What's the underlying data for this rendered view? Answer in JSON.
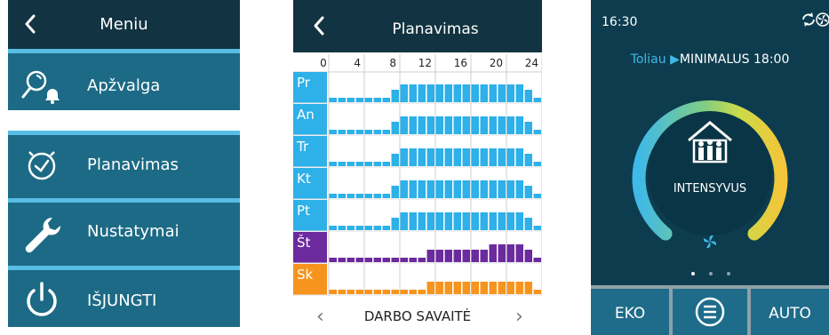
{
  "menu": {
    "title": "Meniu",
    "items": [
      {
        "label": "Apžvalga",
        "icon": "search-alarm-icon"
      },
      {
        "label": "Planavimas",
        "icon": "clock-icon"
      },
      {
        "label": "Nustatymai",
        "icon": "wrench-icon"
      },
      {
        "label": "IŠJUNGTI",
        "icon": "power-icon"
      }
    ]
  },
  "schedule": {
    "title": "Planavimas",
    "hours": [
      "0",
      "4",
      "8",
      "12",
      "16",
      "20",
      "24"
    ],
    "days": [
      {
        "label": "Pr",
        "color": "#2eb0e8",
        "levels": [
          1,
          1,
          1,
          1,
          1,
          1,
          1,
          2,
          3,
          3,
          3,
          3,
          3,
          3,
          3,
          3,
          3,
          3,
          3,
          3,
          3,
          3,
          2,
          1
        ]
      },
      {
        "label": "An",
        "color": "#2eb0e8",
        "levels": [
          1,
          1,
          1,
          1,
          1,
          1,
          1,
          2,
          3,
          3,
          3,
          3,
          3,
          3,
          3,
          3,
          3,
          3,
          3,
          3,
          3,
          3,
          2,
          1
        ]
      },
      {
        "label": "Tr",
        "color": "#2eb0e8",
        "levels": [
          1,
          1,
          1,
          1,
          1,
          1,
          1,
          2,
          3,
          3,
          3,
          3,
          3,
          3,
          3,
          3,
          3,
          3,
          3,
          3,
          3,
          3,
          2,
          1
        ]
      },
      {
        "label": "Kt",
        "color": "#2eb0e8",
        "levels": [
          1,
          1,
          1,
          1,
          1,
          1,
          1,
          2,
          3,
          3,
          3,
          3,
          3,
          3,
          3,
          3,
          3,
          3,
          3,
          3,
          3,
          3,
          2,
          1
        ]
      },
      {
        "label": "Pt",
        "color": "#2eb0e8",
        "levels": [
          1,
          1,
          1,
          1,
          1,
          1,
          1,
          2,
          3,
          3,
          3,
          3,
          3,
          3,
          3,
          3,
          3,
          3,
          3,
          3,
          3,
          3,
          2,
          1
        ]
      },
      {
        "label": "Št",
        "color": "#6b2a9e",
        "levels": [
          1,
          1,
          1,
          1,
          1,
          1,
          1,
          1,
          1,
          1,
          1,
          2,
          2,
          2,
          2,
          2,
          2,
          2,
          3,
          3,
          3,
          3,
          2,
          1
        ]
      },
      {
        "label": "Sk",
        "color": "#f7941d",
        "levels": [
          1,
          1,
          1,
          1,
          1,
          1,
          1,
          1,
          1,
          1,
          1,
          2,
          2,
          2,
          2,
          2,
          2,
          2,
          2,
          2,
          2,
          2,
          2,
          1
        ]
      }
    ],
    "footer": "DARBO SAVAITĖ"
  },
  "home": {
    "time": "16:30",
    "next_label": "Toliau",
    "next_mode": "MINIMALUS 18:00",
    "mode": "INTENSYVUS",
    "buttons": {
      "left": "EKO",
      "right": "AUTO"
    },
    "accent": "#3fb9e8"
  }
}
